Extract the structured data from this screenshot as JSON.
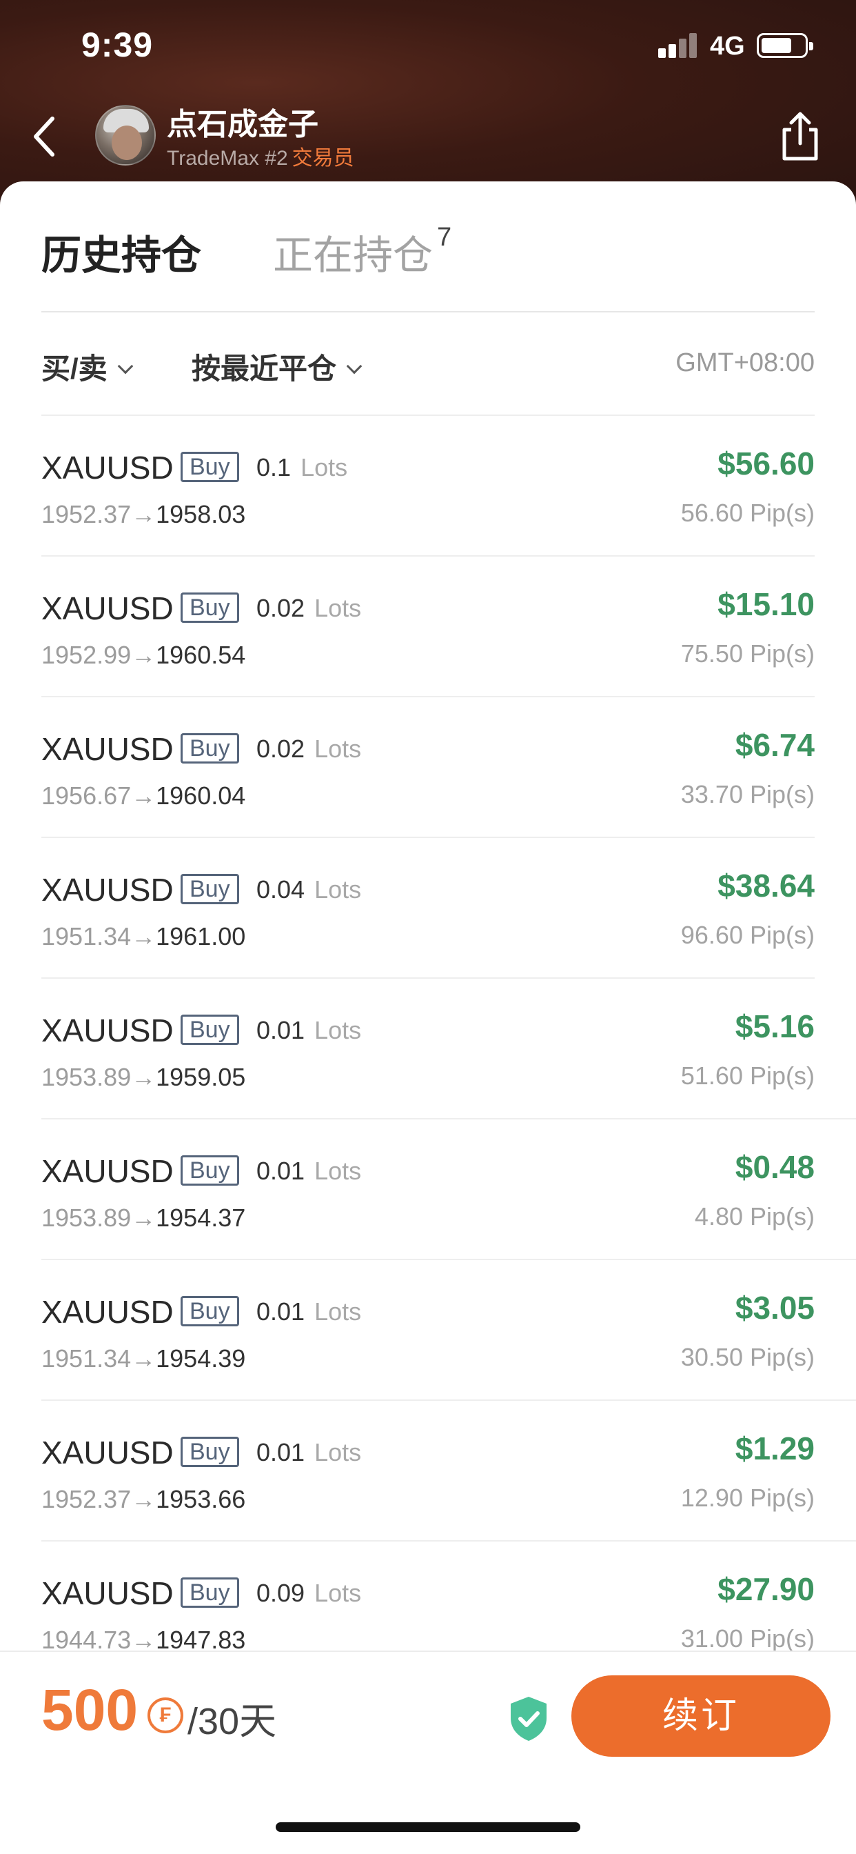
{
  "status_bar": {
    "time": "9:39",
    "network": "4G",
    "battery_level": 0.7
  },
  "trader": {
    "name": "点石成金子",
    "subtitle": "TradeMax #2",
    "role": "交易员"
  },
  "tabs": {
    "history": "历史持仓",
    "open": "正在持仓",
    "open_count": "7"
  },
  "filters": {
    "side": "买/卖",
    "sort": "按最近平仓",
    "timezone": "GMT+08:00"
  },
  "positions": [
    {
      "symbol": "XAUUSD",
      "side": "Buy",
      "lots": "0.1",
      "lots_unit": "Lots",
      "open": "1952.37",
      "close": "1958.03",
      "profit": "$56.60",
      "pips": "56.60 Pip(s)"
    },
    {
      "symbol": "XAUUSD",
      "side": "Buy",
      "lots": "0.02",
      "lots_unit": "Lots",
      "open": "1952.99",
      "close": "1960.54",
      "profit": "$15.10",
      "pips": "75.50 Pip(s)"
    },
    {
      "symbol": "XAUUSD",
      "side": "Buy",
      "lots": "0.02",
      "lots_unit": "Lots",
      "open": "1956.67",
      "close": "1960.04",
      "profit": "$6.74",
      "pips": "33.70 Pip(s)"
    },
    {
      "symbol": "XAUUSD",
      "side": "Buy",
      "lots": "0.04",
      "lots_unit": "Lots",
      "open": "1951.34",
      "close": "1961.00",
      "profit": "$38.64",
      "pips": "96.60 Pip(s)"
    },
    {
      "symbol": "XAUUSD",
      "side": "Buy",
      "lots": "0.01",
      "lots_unit": "Lots",
      "open": "1953.89",
      "close": "1959.05",
      "profit": "$5.16",
      "pips": "51.60 Pip(s)"
    },
    {
      "symbol": "XAUUSD",
      "side": "Buy",
      "lots": "0.01",
      "lots_unit": "Lots",
      "open": "1953.89",
      "close": "1954.37",
      "profit": "$0.48",
      "pips": "4.80 Pip(s)"
    },
    {
      "symbol": "XAUUSD",
      "side": "Buy",
      "lots": "0.01",
      "lots_unit": "Lots",
      "open": "1951.34",
      "close": "1954.39",
      "profit": "$3.05",
      "pips": "30.50 Pip(s)"
    },
    {
      "symbol": "XAUUSD",
      "side": "Buy",
      "lots": "0.01",
      "lots_unit": "Lots",
      "open": "1952.37",
      "close": "1953.66",
      "profit": "$1.29",
      "pips": "12.90 Pip(s)"
    },
    {
      "symbol": "XAUUSD",
      "side": "Buy",
      "lots": "0.09",
      "lots_unit": "Lots",
      "open": "1944.73",
      "close": "1947.83",
      "profit": "$27.90",
      "pips": "31.00 Pip(s)"
    }
  ],
  "arrow": "→",
  "subscription": {
    "price": "500",
    "coin_symbol": "₣",
    "period": "/30天",
    "renew_label": "续订"
  },
  "colors": {
    "accent": "#ec6d2c",
    "profit_green": "#3d9460",
    "badge_blue": "#55647a",
    "shield_green": "#4cc39a"
  }
}
